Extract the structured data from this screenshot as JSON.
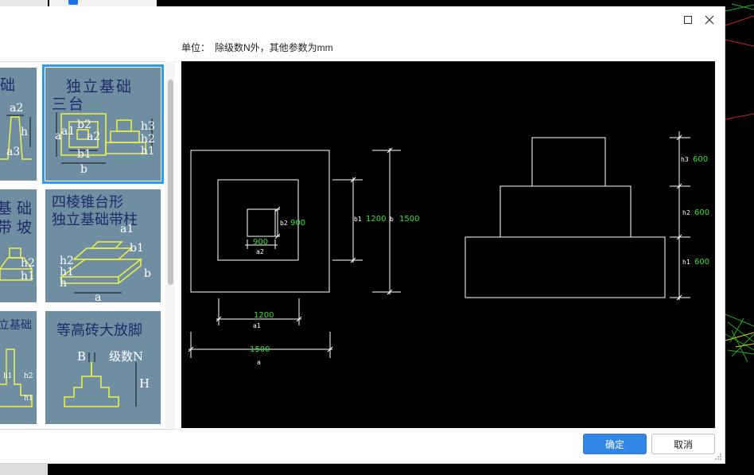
{
  "dialog": {
    "unit_label": "单位：",
    "unit_text": "除级数N外，其他参数为mm",
    "ok_label": "确定",
    "cancel_label": "取消"
  },
  "gallery": {
    "tiles": [
      {
        "title_line1": "础",
        "title_line2": ""
      },
      {
        "title_line1": "独立基础",
        "title_line2": "三台",
        "selected": true
      },
      {
        "title_line1": "基 础",
        "title_line2": "带 坡"
      },
      {
        "title_line1": "四棱锥台形",
        "title_line2": "独立基础带柱"
      },
      {
        "title_line1": "立基础",
        "title_line2": ""
      },
      {
        "title_line1": "等高砖大放脚",
        "title_line2": ""
      }
    ],
    "labels": {
      "a2": "a2",
      "h": "h",
      "a3": "a3",
      "a": "a",
      "a1": "a1",
      "b2": "b2",
      "b1": "b1",
      "b": "b",
      "h1": "h1",
      "h2": "h2",
      "h3": "h3",
      "B": "B",
      "levels": "级数N",
      "H": "H"
    }
  },
  "cad": {
    "plan": {
      "b2": "b2",
      "b2_val": "900",
      "inner_w": "900",
      "a2": "a2",
      "b1": "b1",
      "b1_val": "1200",
      "b": "b",
      "b_val": "1500",
      "mid_w": "1200",
      "a1": "a1",
      "outer_w": "1500",
      "a": "a"
    },
    "elevation": {
      "h3": "h3",
      "h3_val": "600",
      "h2": "h2",
      "h2_val": "600",
      "h1": "h1",
      "h1_val": "600"
    }
  },
  "colors": {
    "accent": "#2f86e4",
    "tile_bg": "#6f8ea2",
    "tile_title": "#1f2a6b",
    "sketch_yellow": "#f2f24a",
    "cad_white": "#ffffff",
    "cad_green": "#2ee52e",
    "selected_border": "#2b9bf4"
  },
  "icons": [
    "maximize-icon",
    "close-icon",
    "resize-grip-icon"
  ]
}
